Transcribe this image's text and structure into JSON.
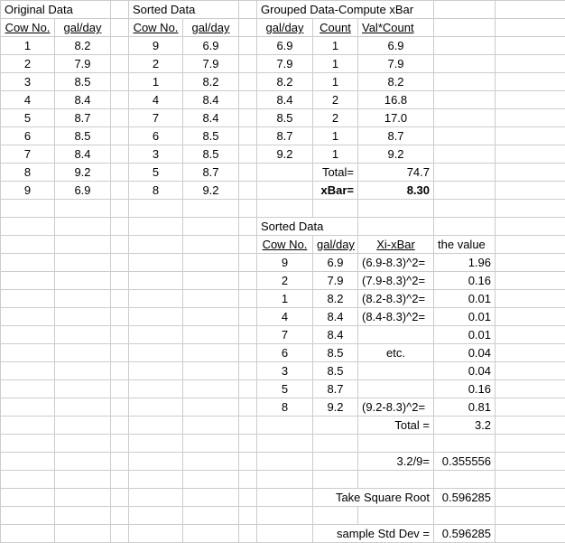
{
  "headers": {
    "original": "Original Data",
    "sorted": "Sorted Data",
    "grouped": "Grouped Data-Compute xBar",
    "cowNo": "Cow No.",
    "galDay": "gal/day",
    "count": "Count",
    "valCount": "Val*Count",
    "xi": "Xi-xBar",
    "theValue": "the value",
    "totalEq": "Total=",
    "xbarEq": "xBar=",
    "sorted2": "Sorted Data",
    "totalEq2": "Total =",
    "div": "3.2/9=",
    "sqrt": "Take Square Root",
    "std": "sample Std Dev =",
    "etc": "etc."
  },
  "orig": [
    {
      "c": "1",
      "g": "8.2"
    },
    {
      "c": "2",
      "g": "7.9"
    },
    {
      "c": "3",
      "g": "8.5"
    },
    {
      "c": "4",
      "g": "8.4"
    },
    {
      "c": "5",
      "g": "8.7"
    },
    {
      "c": "6",
      "g": "8.5"
    },
    {
      "c": "7",
      "g": "8.4"
    },
    {
      "c": "8",
      "g": "9.2"
    },
    {
      "c": "9",
      "g": "6.9"
    }
  ],
  "sort1": [
    {
      "c": "9",
      "g": "6.9"
    },
    {
      "c": "2",
      "g": "7.9"
    },
    {
      "c": "1",
      "g": "8.2"
    },
    {
      "c": "4",
      "g": "8.4"
    },
    {
      "c": "7",
      "g": "8.4"
    },
    {
      "c": "6",
      "g": "8.5"
    },
    {
      "c": "3",
      "g": "8.5"
    },
    {
      "c": "5",
      "g": "8.7"
    },
    {
      "c": "8",
      "g": "9.2"
    }
  ],
  "group": [
    {
      "g": "6.9",
      "cnt": "1",
      "vc": "6.9"
    },
    {
      "g": "7.9",
      "cnt": "1",
      "vc": "7.9"
    },
    {
      "g": "8.2",
      "cnt": "1",
      "vc": "8.2"
    },
    {
      "g": "8.4",
      "cnt": "2",
      "vc": "16.8"
    },
    {
      "g": "8.5",
      "cnt": "2",
      "vc": "17.0"
    },
    {
      "g": "8.7",
      "cnt": "1",
      "vc": "8.7"
    },
    {
      "g": "9.2",
      "cnt": "1",
      "vc": "9.2"
    }
  ],
  "totals": {
    "sum": "74.7",
    "xbar": "8.30"
  },
  "sort2": [
    {
      "c": "9",
      "g": "6.9",
      "f": "(6.9-8.3)^2=",
      "v": "1.96"
    },
    {
      "c": "2",
      "g": "7.9",
      "f": "(7.9-8.3)^2=",
      "v": "0.16"
    },
    {
      "c": "1",
      "g": "8.2",
      "f": "(8.2-8.3)^2=",
      "v": "0.01"
    },
    {
      "c": "4",
      "g": "8.4",
      "f": "(8.4-8.3)^2=",
      "v": "0.01"
    },
    {
      "c": "7",
      "g": "8.4",
      "f": "",
      "v": "0.01"
    },
    {
      "c": "6",
      "g": "8.5",
      "f": "etc.",
      "v": "0.04"
    },
    {
      "c": "3",
      "g": "8.5",
      "f": "",
      "v": "0.04"
    },
    {
      "c": "5",
      "g": "8.7",
      "f": "",
      "v": "0.16"
    },
    {
      "c": "8",
      "g": "9.2",
      "f": "(9.2-8.3)^2=",
      "v": "0.81"
    }
  ],
  "sums": {
    "total": "3.2",
    "div": "0.355556",
    "sqrt": "0.596285",
    "std": "0.596285"
  }
}
